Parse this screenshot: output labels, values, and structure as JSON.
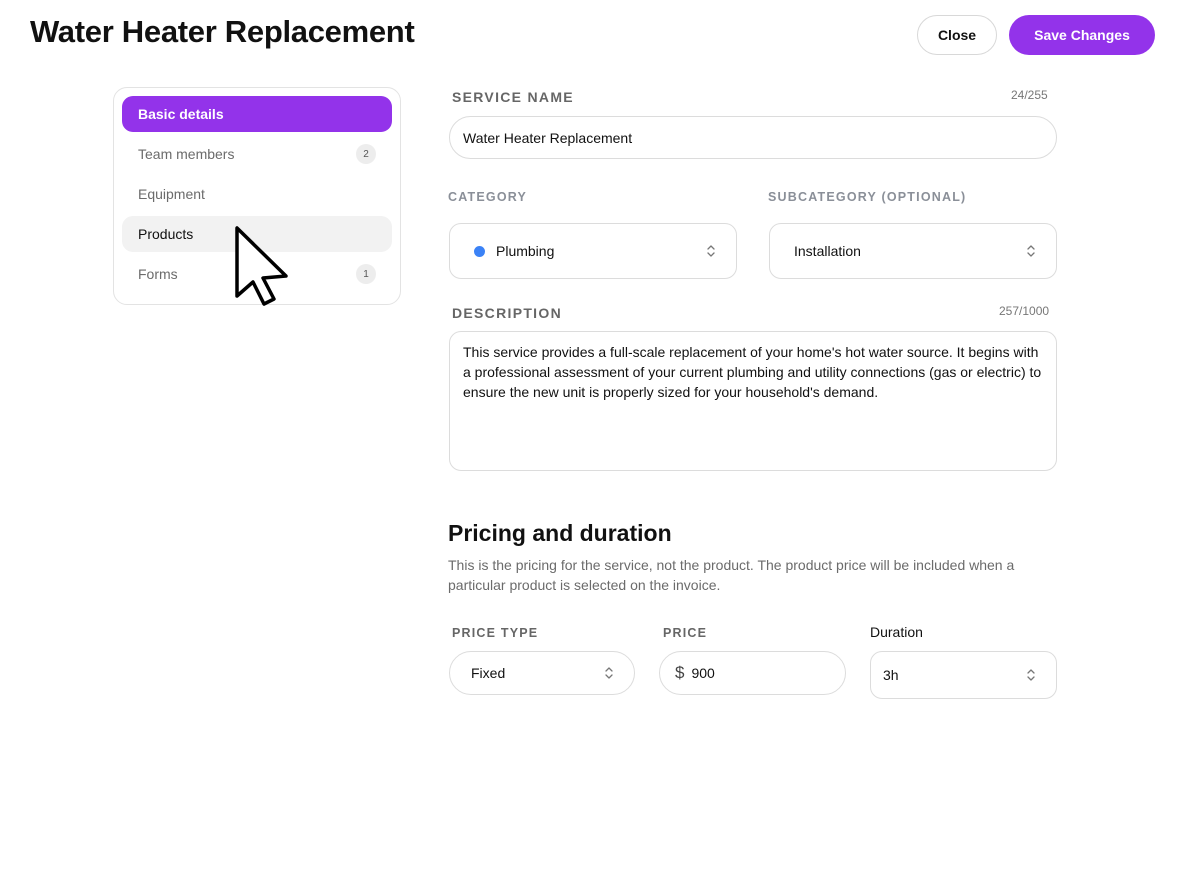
{
  "header": {
    "title": "Water Heater Replacement",
    "close_label": "Close",
    "save_label": "Save Changes"
  },
  "colors": {
    "accent": "#9333ea",
    "category_dot": "#3b82f6"
  },
  "sidebar": {
    "items": [
      {
        "label": "Basic details",
        "state": "active"
      },
      {
        "label": "Team members",
        "badge": "2"
      },
      {
        "label": "Equipment"
      },
      {
        "label": "Products",
        "state": "hover"
      },
      {
        "label": "Forms",
        "badge": "1"
      }
    ]
  },
  "form": {
    "service_name": {
      "label": "SERVICE NAME",
      "counter": "24/255",
      "value": "Water Heater Replacement"
    },
    "category": {
      "label": "CATEGORY",
      "value": "Plumbing"
    },
    "subcategory": {
      "label": "SUBCATEGORY (OPTIONAL)",
      "value": "Installation"
    },
    "description": {
      "label": "DESCRIPTION",
      "counter": "257/1000",
      "value": "This service provides a full-scale replacement of your home's hot water source. It begins with a professional assessment of your current plumbing and utility connections (gas or electric) to ensure the new unit is properly sized for your household's demand."
    }
  },
  "pricing": {
    "title": "Pricing and duration",
    "description": "This is the pricing for the service, not the product. The product price will be included when a particular product is selected on the invoice.",
    "price_type": {
      "label": "PRICE TYPE",
      "value": "Fixed"
    },
    "price": {
      "label": "PRICE",
      "currency": "$",
      "value": "900"
    },
    "duration": {
      "label": "Duration",
      "value": "3h"
    }
  },
  "icons": {
    "select_chevron": "chevron-up-down-icon",
    "cursor": "mouse-pointer-icon"
  }
}
